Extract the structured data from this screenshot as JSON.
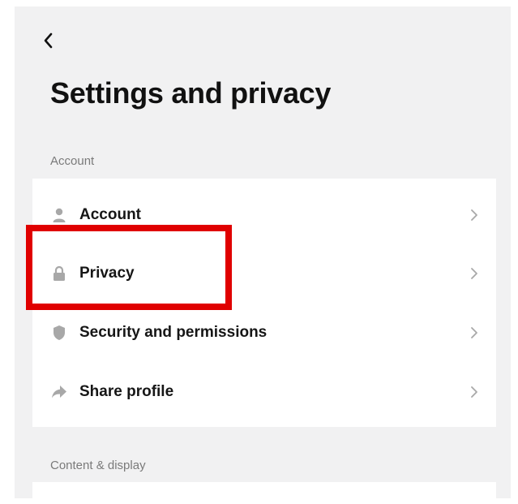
{
  "header": {
    "back_icon": "chevron-left-icon",
    "title": "Settings and privacy"
  },
  "sections": [
    {
      "title": "Account",
      "items": [
        {
          "label": "Account",
          "icon": "person-icon"
        },
        {
          "label": "Privacy",
          "icon": "lock-icon"
        },
        {
          "label": "Security and permissions",
          "icon": "shield-icon"
        },
        {
          "label": "Share profile",
          "icon": "share-icon"
        }
      ]
    },
    {
      "title": "Content & display",
      "items": []
    }
  ],
  "colors": {
    "background": "#f1f1f2",
    "card": "#ffffff",
    "text": "#161616",
    "section_text": "#7a7a7a",
    "icon": "#a8a8a8",
    "highlight": "#e00000"
  }
}
